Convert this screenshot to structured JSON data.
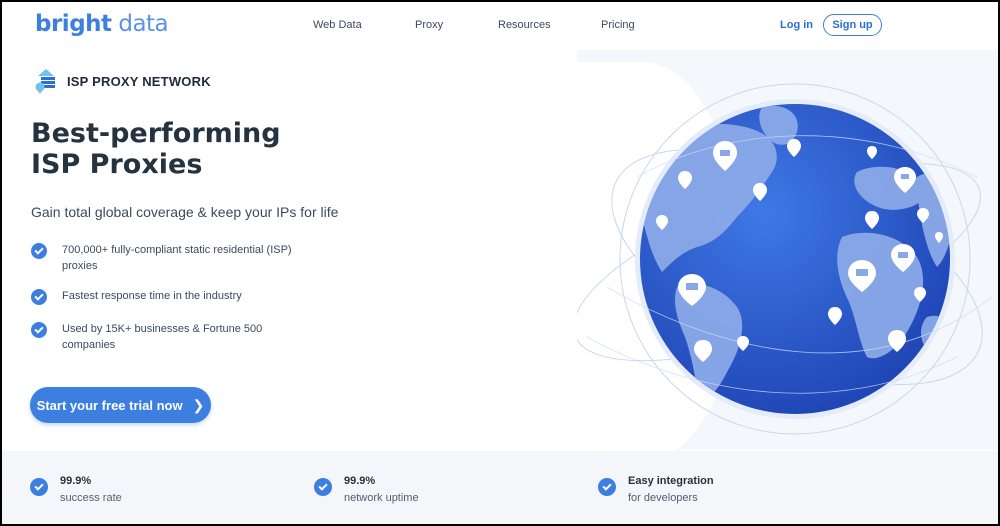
{
  "header": {
    "logo_bold": "bright",
    "logo_light": " data",
    "nav": [
      "Web Data",
      "Proxy",
      "Resources",
      "Pricing"
    ],
    "login": "Log in",
    "signup": "Sign up"
  },
  "hero": {
    "badge": "ISP PROXY NETWORK",
    "title_line1": "Best-performing",
    "title_line2": "ISP Proxies",
    "subtitle": "Gain total global coverage & keep your IPs for life",
    "features": [
      "700,000+ fully-compliant static residential (ISP) proxies",
      "Fastest response time in the industry",
      "Used by 15K+ businesses & Fortune 500 companies"
    ],
    "cta": "Start your free trial now",
    "cta_icon": "chevron-right-icon"
  },
  "stats": [
    {
      "value": "99.9%",
      "label": "success rate"
    },
    {
      "value": "99.9%",
      "label": "network uptime"
    },
    {
      "value": "Easy integration",
      "label": "for developers"
    }
  ],
  "colors": {
    "accent": "#3d7fe0",
    "globe_ocean": "#2454c9",
    "globe_land": "#7e9fe3",
    "stats_bg": "#f4f6fa"
  }
}
